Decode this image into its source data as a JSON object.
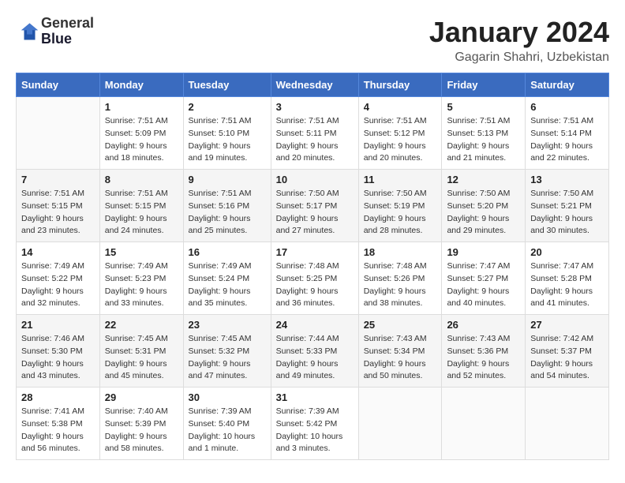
{
  "header": {
    "logo_line1": "General",
    "logo_line2": "Blue",
    "title": "January 2024",
    "subtitle": "Gagarin Shahri, Uzbekistan"
  },
  "weekdays": [
    "Sunday",
    "Monday",
    "Tuesday",
    "Wednesday",
    "Thursday",
    "Friday",
    "Saturday"
  ],
  "weeks": [
    [
      {
        "day": "",
        "info": ""
      },
      {
        "day": "1",
        "info": "Sunrise: 7:51 AM\nSunset: 5:09 PM\nDaylight: 9 hours\nand 18 minutes."
      },
      {
        "day": "2",
        "info": "Sunrise: 7:51 AM\nSunset: 5:10 PM\nDaylight: 9 hours\nand 19 minutes."
      },
      {
        "day": "3",
        "info": "Sunrise: 7:51 AM\nSunset: 5:11 PM\nDaylight: 9 hours\nand 20 minutes."
      },
      {
        "day": "4",
        "info": "Sunrise: 7:51 AM\nSunset: 5:12 PM\nDaylight: 9 hours\nand 20 minutes."
      },
      {
        "day": "5",
        "info": "Sunrise: 7:51 AM\nSunset: 5:13 PM\nDaylight: 9 hours\nand 21 minutes."
      },
      {
        "day": "6",
        "info": "Sunrise: 7:51 AM\nSunset: 5:14 PM\nDaylight: 9 hours\nand 22 minutes."
      }
    ],
    [
      {
        "day": "7",
        "info": "Sunrise: 7:51 AM\nSunset: 5:15 PM\nDaylight: 9 hours\nand 23 minutes."
      },
      {
        "day": "8",
        "info": "Sunrise: 7:51 AM\nSunset: 5:15 PM\nDaylight: 9 hours\nand 24 minutes."
      },
      {
        "day": "9",
        "info": "Sunrise: 7:51 AM\nSunset: 5:16 PM\nDaylight: 9 hours\nand 25 minutes."
      },
      {
        "day": "10",
        "info": "Sunrise: 7:50 AM\nSunset: 5:17 PM\nDaylight: 9 hours\nand 27 minutes."
      },
      {
        "day": "11",
        "info": "Sunrise: 7:50 AM\nSunset: 5:19 PM\nDaylight: 9 hours\nand 28 minutes."
      },
      {
        "day": "12",
        "info": "Sunrise: 7:50 AM\nSunset: 5:20 PM\nDaylight: 9 hours\nand 29 minutes."
      },
      {
        "day": "13",
        "info": "Sunrise: 7:50 AM\nSunset: 5:21 PM\nDaylight: 9 hours\nand 30 minutes."
      }
    ],
    [
      {
        "day": "14",
        "info": "Sunrise: 7:49 AM\nSunset: 5:22 PM\nDaylight: 9 hours\nand 32 minutes."
      },
      {
        "day": "15",
        "info": "Sunrise: 7:49 AM\nSunset: 5:23 PM\nDaylight: 9 hours\nand 33 minutes."
      },
      {
        "day": "16",
        "info": "Sunrise: 7:49 AM\nSunset: 5:24 PM\nDaylight: 9 hours\nand 35 minutes."
      },
      {
        "day": "17",
        "info": "Sunrise: 7:48 AM\nSunset: 5:25 PM\nDaylight: 9 hours\nand 36 minutes."
      },
      {
        "day": "18",
        "info": "Sunrise: 7:48 AM\nSunset: 5:26 PM\nDaylight: 9 hours\nand 38 minutes."
      },
      {
        "day": "19",
        "info": "Sunrise: 7:47 AM\nSunset: 5:27 PM\nDaylight: 9 hours\nand 40 minutes."
      },
      {
        "day": "20",
        "info": "Sunrise: 7:47 AM\nSunset: 5:28 PM\nDaylight: 9 hours\nand 41 minutes."
      }
    ],
    [
      {
        "day": "21",
        "info": "Sunrise: 7:46 AM\nSunset: 5:30 PM\nDaylight: 9 hours\nand 43 minutes."
      },
      {
        "day": "22",
        "info": "Sunrise: 7:45 AM\nSunset: 5:31 PM\nDaylight: 9 hours\nand 45 minutes."
      },
      {
        "day": "23",
        "info": "Sunrise: 7:45 AM\nSunset: 5:32 PM\nDaylight: 9 hours\nand 47 minutes."
      },
      {
        "day": "24",
        "info": "Sunrise: 7:44 AM\nSunset: 5:33 PM\nDaylight: 9 hours\nand 49 minutes."
      },
      {
        "day": "25",
        "info": "Sunrise: 7:43 AM\nSunset: 5:34 PM\nDaylight: 9 hours\nand 50 minutes."
      },
      {
        "day": "26",
        "info": "Sunrise: 7:43 AM\nSunset: 5:36 PM\nDaylight: 9 hours\nand 52 minutes."
      },
      {
        "day": "27",
        "info": "Sunrise: 7:42 AM\nSunset: 5:37 PM\nDaylight: 9 hours\nand 54 minutes."
      }
    ],
    [
      {
        "day": "28",
        "info": "Sunrise: 7:41 AM\nSunset: 5:38 PM\nDaylight: 9 hours\nand 56 minutes."
      },
      {
        "day": "29",
        "info": "Sunrise: 7:40 AM\nSunset: 5:39 PM\nDaylight: 9 hours\nand 58 minutes."
      },
      {
        "day": "30",
        "info": "Sunrise: 7:39 AM\nSunset: 5:40 PM\nDaylight: 10 hours\nand 1 minute."
      },
      {
        "day": "31",
        "info": "Sunrise: 7:39 AM\nSunset: 5:42 PM\nDaylight: 10 hours\nand 3 minutes."
      },
      {
        "day": "",
        "info": ""
      },
      {
        "day": "",
        "info": ""
      },
      {
        "day": "",
        "info": ""
      }
    ]
  ]
}
